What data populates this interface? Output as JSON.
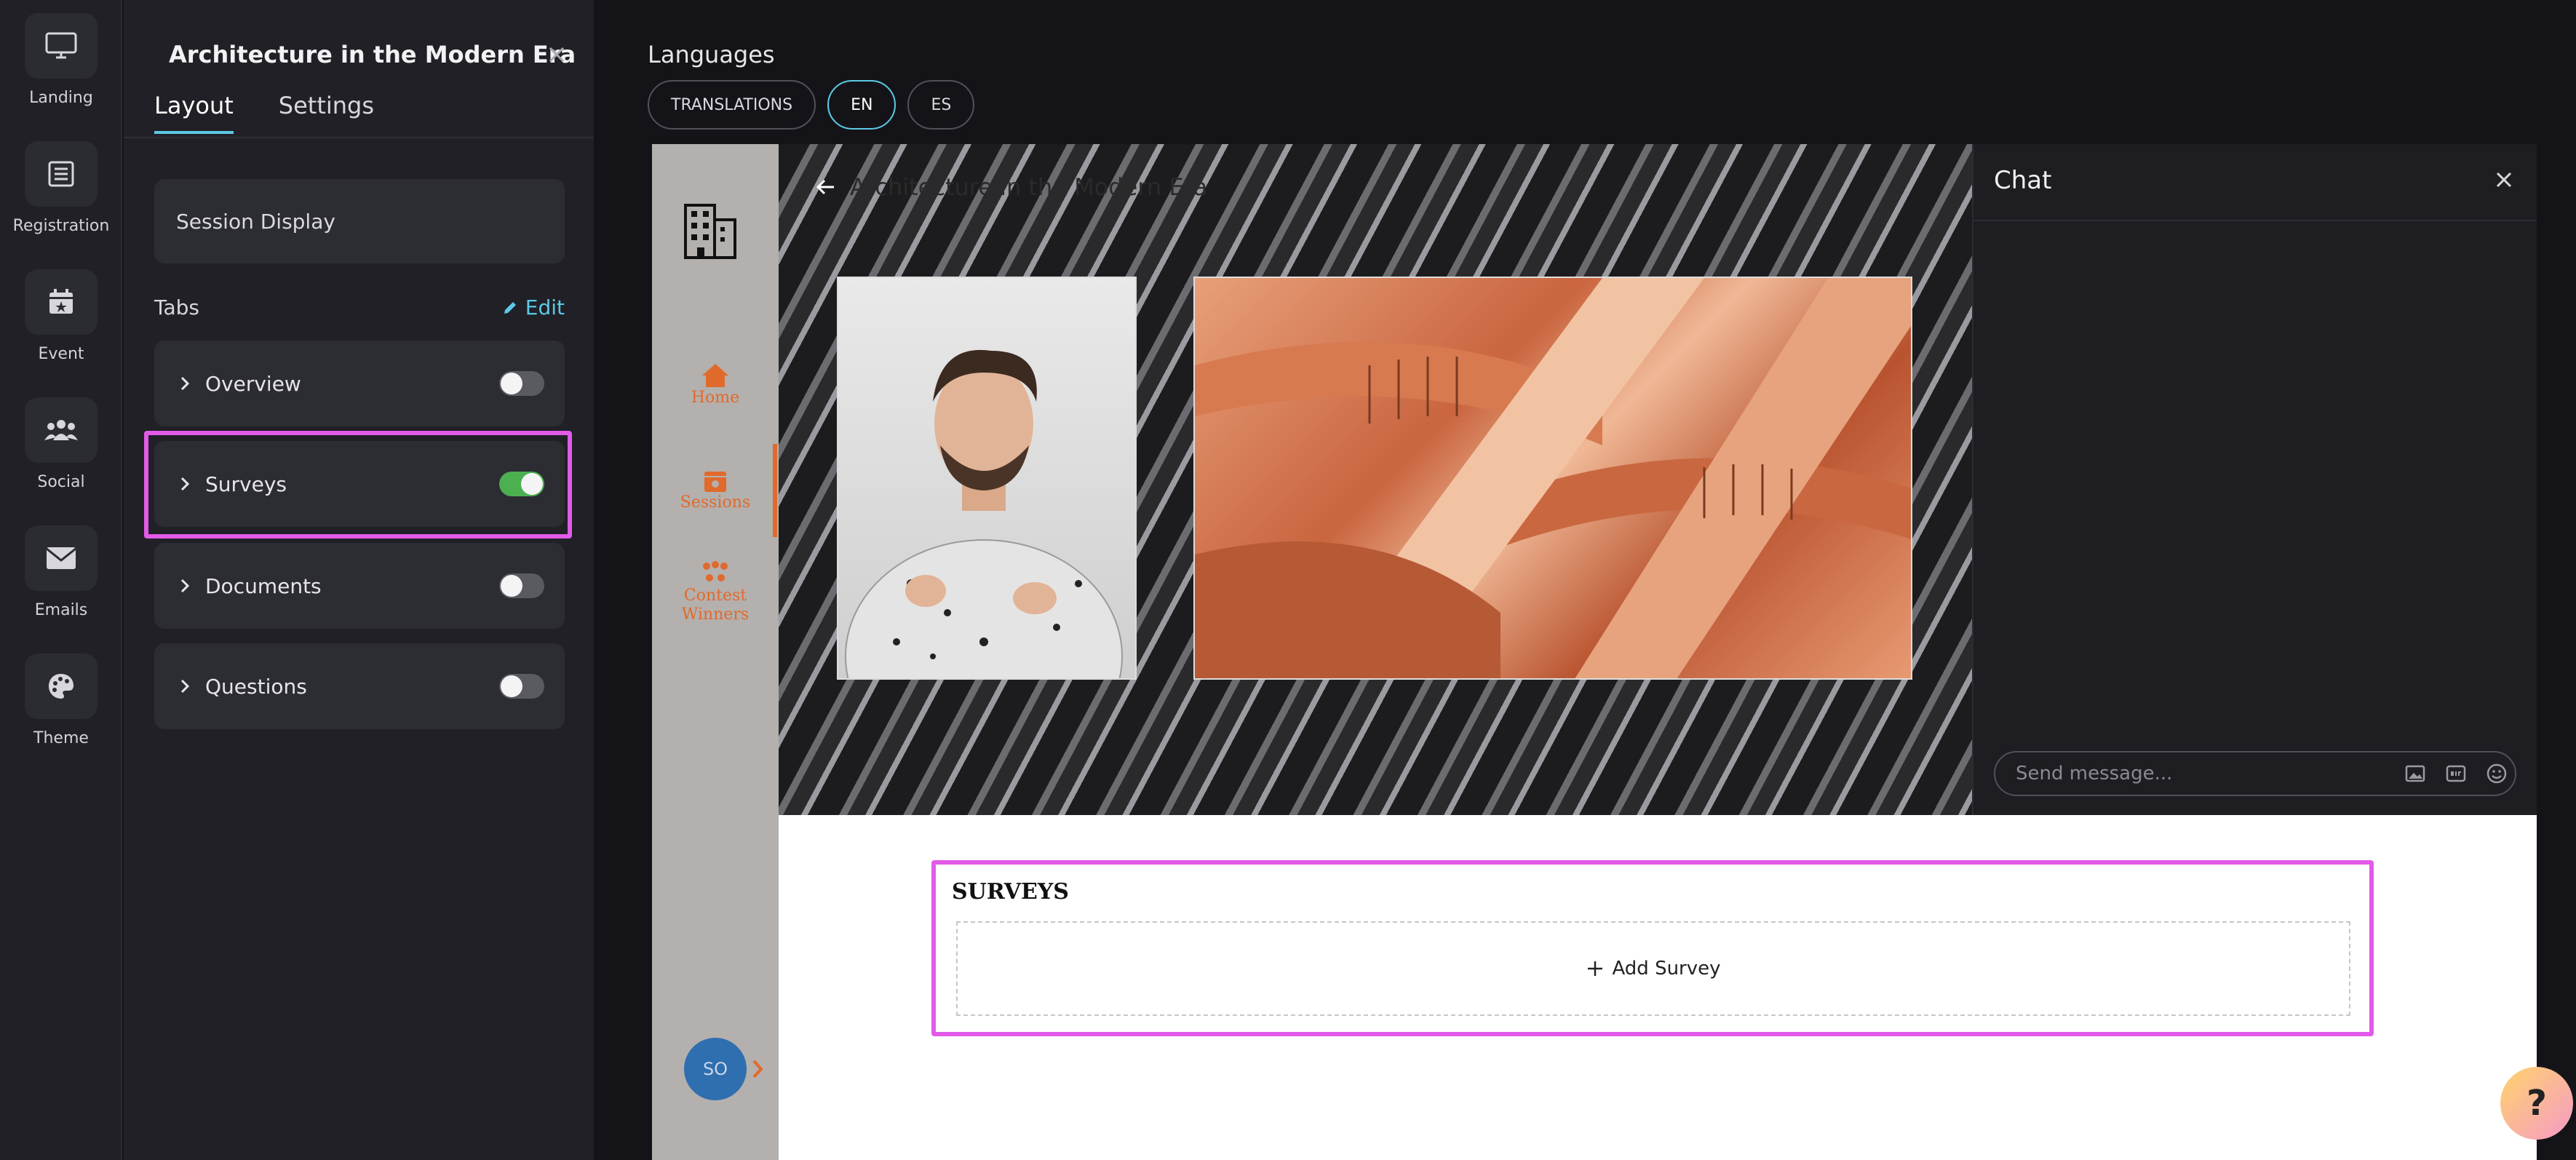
{
  "rail": {
    "items": [
      {
        "label": "Landing",
        "icon": "monitor-icon"
      },
      {
        "label": "Registration",
        "icon": "list-icon"
      },
      {
        "label": "Event",
        "icon": "calendar-icon"
      },
      {
        "label": "Social",
        "icon": "people-icon"
      },
      {
        "label": "Emails",
        "icon": "mail-icon"
      },
      {
        "label": "Theme",
        "icon": "palette-icon"
      }
    ]
  },
  "panel": {
    "title": "Architecture in the Modern Era",
    "tabs": [
      {
        "label": "Layout"
      },
      {
        "label": "Settings"
      }
    ],
    "session_display": "Session Display",
    "tabs_label": "Tabs",
    "edit_label": "Edit",
    "tab_items": [
      {
        "label": "Overview",
        "enabled": false
      },
      {
        "label": "Surveys",
        "enabled": true
      },
      {
        "label": "Documents",
        "enabled": false
      },
      {
        "label": "Questions",
        "enabled": false
      }
    ]
  },
  "languages": {
    "title": "Languages",
    "pills": [
      {
        "label": "TRANSLATIONS"
      },
      {
        "label": "EN"
      },
      {
        "label": "ES"
      }
    ]
  },
  "preview": {
    "nav": [
      {
        "label": "Home"
      },
      {
        "label": "Sessions"
      },
      {
        "label": "Contest Winners"
      }
    ],
    "avatar_initials": "SO",
    "hero_title": "Architecture in the Modern Era",
    "chat": {
      "title": "Chat",
      "placeholder": "Send message..."
    },
    "surveys": {
      "heading": "SURVEYS",
      "add_label": "Add Survey"
    }
  },
  "help_label": "?",
  "colors": {
    "accent": "#5cc9e6",
    "highlight": "#e25ae8",
    "toggle_on": "#4caf50",
    "brand_orange": "#e06a2c"
  }
}
